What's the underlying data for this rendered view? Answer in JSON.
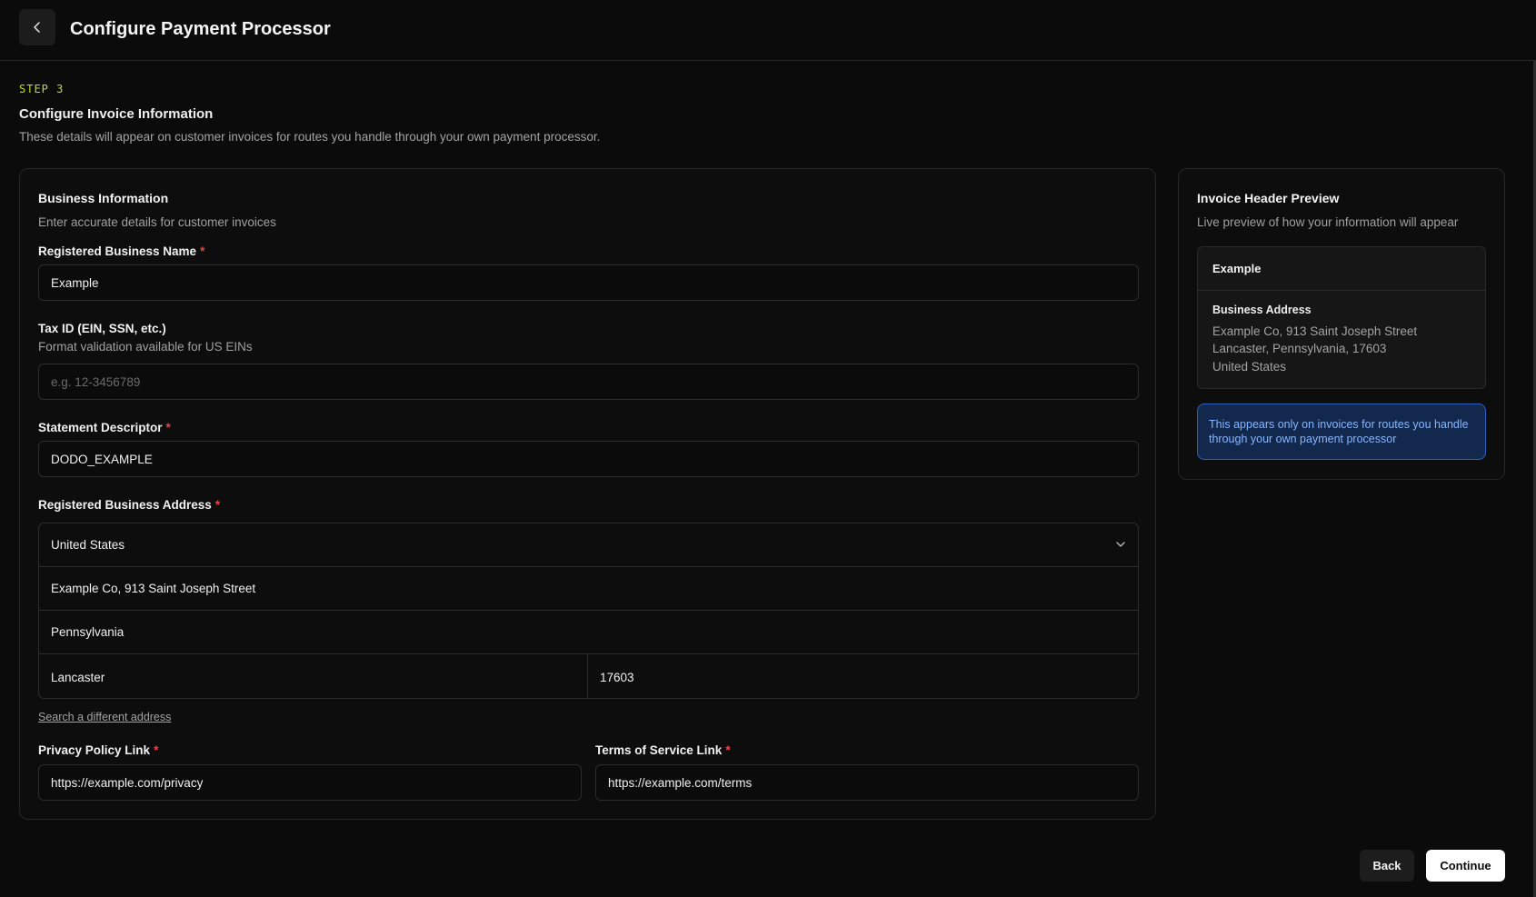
{
  "header": {
    "title": "Configure Payment Processor",
    "back_icon": "chevron-left-icon"
  },
  "step": {
    "label": "STEP 3",
    "title": "Configure Invoice Information",
    "description": "These details will appear on customer invoices for routes you handle through your own payment processor."
  },
  "business": {
    "title": "Business Information",
    "subtitle": "Enter accurate details for customer invoices",
    "business_name": {
      "label": "Registered Business Name",
      "required_mark": "*",
      "value": "Example"
    },
    "tax_id": {
      "label": "Tax ID (EIN, SSN, etc.)",
      "hint": "Format validation available for US EINs",
      "value": "",
      "placeholder": "e.g. 12-3456789"
    },
    "statement_descriptor": {
      "label": "Statement Descriptor",
      "required_mark": "*",
      "value": "DODO_EXAMPLE"
    },
    "address": {
      "label": "Registered Business Address",
      "required_mark": "*",
      "country": "United States",
      "street": "Example Co, 913 Saint Joseph Street",
      "state": "Pennsylvania",
      "city": "Lancaster",
      "zip": "17603",
      "search_link": "Search a different address"
    },
    "privacy_link": {
      "label": "Privacy Policy Link",
      "required_mark": "*",
      "value": "https://example.com/privacy"
    },
    "terms_link": {
      "label": "Terms of Service Link",
      "required_mark": "*",
      "value": "https://example.com/terms"
    }
  },
  "preview": {
    "title": "Invoice Header Preview",
    "subtitle": "Live preview of how your information will appear",
    "business_name": "Example",
    "address_title": "Business Address",
    "address_line1": "Example Co, 913 Saint Joseph Street",
    "address_line2": "Lancaster, Pennsylvania, 17603",
    "address_line3": "United States",
    "notice": "This appears only on invoices for routes you handle through your own payment processor"
  },
  "footer": {
    "back_label": "Back",
    "continue_label": "Continue"
  },
  "colors": {
    "accent": "#b6e02a",
    "required": "#ef4444",
    "info_bg": "#13284d",
    "info_text": "#86b6ff"
  }
}
